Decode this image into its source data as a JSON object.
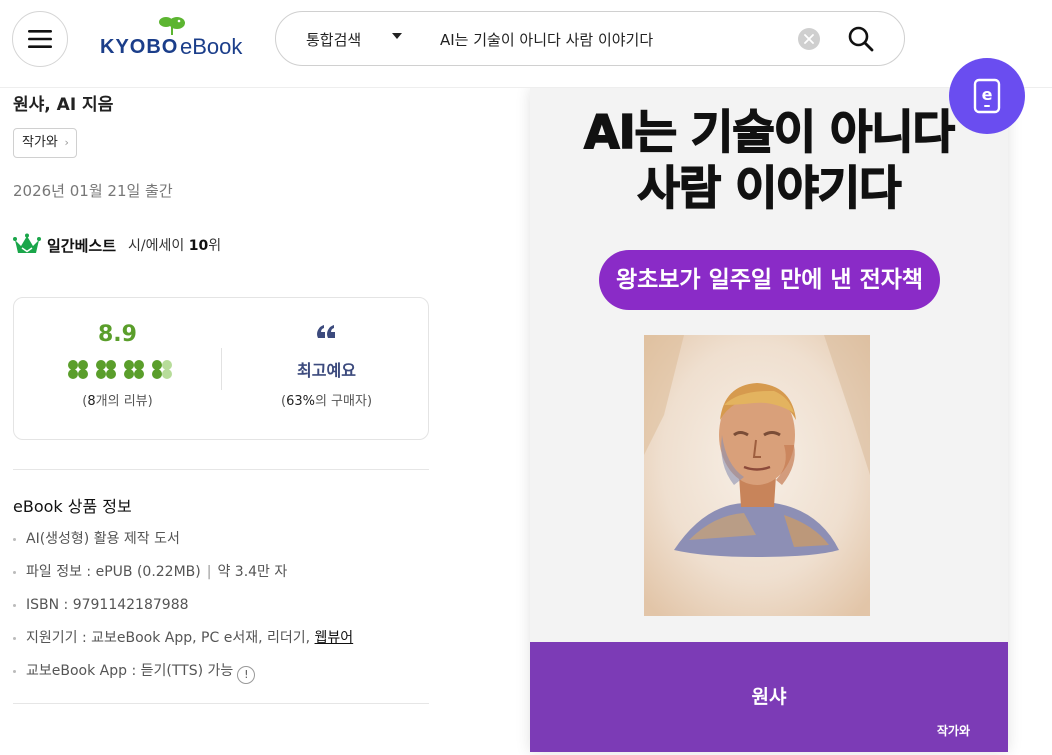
{
  "header": {
    "logo_kyobo": "KYOBO",
    "logo_ebook": "eBook",
    "search_category": "통합검색",
    "search_value": "AI는 기술이 아니다 사람 이야기다"
  },
  "product": {
    "author_line": "원샤, AI 지음",
    "publisher": "작가와",
    "pub_date": "2026년 01월 21일 출간",
    "best_label": "일간베스트",
    "best_category": "시/에세이",
    "best_rank": "10",
    "best_rank_unit": "위"
  },
  "rating": {
    "score": "8.9",
    "clover_level": 4.5,
    "review_count_open": "(",
    "review_count_num": "8",
    "review_count_rest": "개의 리뷰)",
    "best_text": "최고예요",
    "buyers_open": "(",
    "buyers_pct": "63%",
    "buyers_rest": "의 구매자)"
  },
  "ebook_info": {
    "title": "eBook 상품 정보",
    "ai_note": "AI(생성형) 활용 제작 도서",
    "file_info": "파일 정보 : ePUB (0.22MB)",
    "sep": "|",
    "char_count": "약 3.4만 자",
    "isbn": "ISBN : 9791142187988",
    "devices_prefix": "지원기기 : 교보eBook App, PC e서재, 리더기,",
    "devices_link": "웹뷰어",
    "tts": "교보eBook App : 듣기(TTS) 가능",
    "info_icon": "!"
  },
  "cover": {
    "title_line1": "AI는 기술이 아니다",
    "title_line2": "사람 이야기다",
    "subtitle": "왕초보가 일주일 만에 낸 전자책",
    "author": "원샤",
    "publisher": "작가와",
    "band_color": "#7c3bb6",
    "pill_color": "#8a2bc7"
  },
  "colors": {
    "accent_green": "#5a9e2b",
    "best_blue": "#3c4a7d",
    "ebadge": "#6a4df0"
  }
}
